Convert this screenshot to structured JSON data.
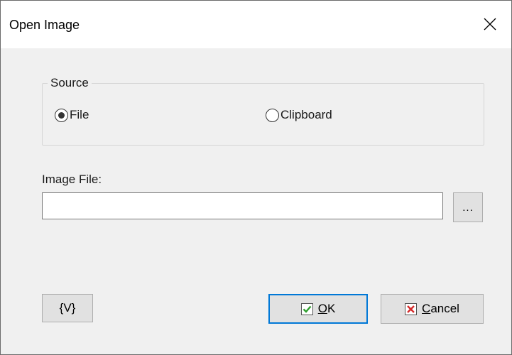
{
  "window": {
    "title": "Open Image",
    "close_glyph": "✕"
  },
  "source_group": {
    "legend": "Source",
    "options": [
      {
        "label": "File",
        "checked": true
      },
      {
        "label": "Clipboard",
        "checked": false
      }
    ]
  },
  "image_file": {
    "label": "Image File:",
    "value": "",
    "browse_label": "..."
  },
  "buttons": {
    "variables_label": "{V}",
    "ok_label": "OK",
    "ok_mnemonic": "O",
    "ok_rest": "K",
    "cancel_label": "Cancel",
    "cancel_mnemonic": "C",
    "cancel_rest": "ancel",
    "ok_icon": "checkmark-icon",
    "cancel_icon": "x-icon"
  },
  "colors": {
    "focus_border": "#0078d7",
    "check_green": "#2e9e2e",
    "cancel_red": "#d42a2a"
  }
}
